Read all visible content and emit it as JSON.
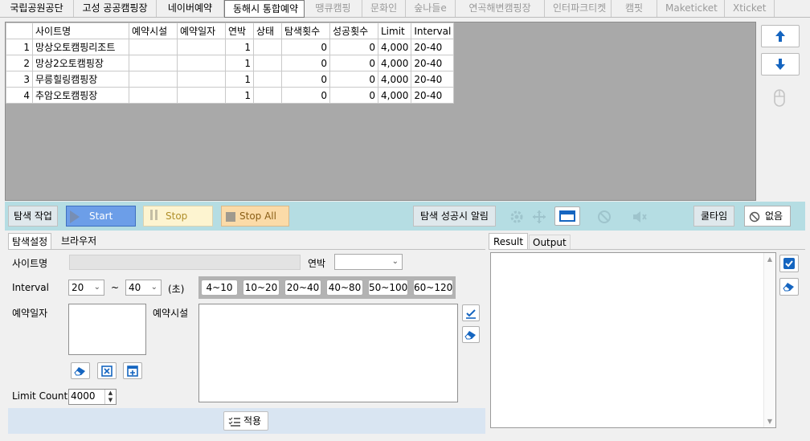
{
  "top_tabs": [
    {
      "label": "국립공원공단",
      "state": "normal"
    },
    {
      "label": "고성 공공캠핑장",
      "state": "normal"
    },
    {
      "label": "네이버예약",
      "state": "normal"
    },
    {
      "label": "동해시 통합예약",
      "state": "active"
    },
    {
      "label": "땡큐캠핑",
      "state": "disabled"
    },
    {
      "label": "문화인",
      "state": "disabled"
    },
    {
      "label": "숲나들e",
      "state": "disabled"
    },
    {
      "label": "연곡해변캠핑장",
      "state": "disabled"
    },
    {
      "label": "인터파크티켓",
      "state": "disabled"
    },
    {
      "label": "캠핏",
      "state": "disabled"
    },
    {
      "label": "Maketicket",
      "state": "disabled"
    },
    {
      "label": "Xticket",
      "state": "disabled"
    }
  ],
  "grid": {
    "columns": [
      "",
      "사이트명",
      "예약시설",
      "예약일자",
      "연박",
      "상태",
      "탐색횟수",
      "성공횟수",
      "Limit",
      "Interval"
    ],
    "rows": [
      [
        "1",
        "망상오토캠핑리조트",
        "",
        "",
        "1",
        "",
        "0",
        "0",
        "4,000",
        "20-40"
      ],
      [
        "2",
        "망상2오토캠핑장",
        "",
        "",
        "1",
        "",
        "0",
        "0",
        "4,000",
        "20-40"
      ],
      [
        "3",
        "무릉힐링캠핑장",
        "",
        "",
        "1",
        "",
        "0",
        "0",
        "4,000",
        "20-40"
      ],
      [
        "4",
        "추암오토캠핑장",
        "",
        "",
        "1",
        "",
        "0",
        "0",
        "4,000",
        "20-40"
      ]
    ]
  },
  "side_buttons": {
    "up": "arrow-up-icon",
    "down": "arrow-down-icon",
    "mouse": "mouse-icon"
  },
  "control_bar": {
    "search_task_label": "탐색 작업",
    "start_label": "Start",
    "stop_label": "Stop",
    "stop_all_label": "Stop All",
    "notify_label": "탐색 성공시 알림",
    "cooltime_label": "쿨타임",
    "cooltime_value": "없음"
  },
  "settings": {
    "tabs": [
      "탐색설정",
      "브라우저"
    ],
    "site_name_label": "사이트명",
    "site_name_value": "",
    "nights_label": "연박",
    "nights_value": "",
    "interval_label": "Interval",
    "interval_from": "20",
    "interval_to": "40",
    "interval_sep": "~",
    "interval_unit": "(초)",
    "interval_presets": [
      "4~10",
      "10~20",
      "20~40",
      "40~80",
      "50~100",
      "60~120"
    ],
    "date_label": "예약일자",
    "facility_label": "예약시설",
    "limit_label": "Limit Count",
    "limit_value": "4000",
    "apply_label": "적용"
  },
  "result": {
    "tabs": [
      "Result",
      "Output"
    ]
  },
  "colors": {
    "start_bg": "#6c9ee8",
    "stop_bg": "#fdf4d0",
    "stop_all_bg": "#fbdba8",
    "ctrl_bar": "#b5dde3",
    "accent_blue": "#1565c0"
  }
}
